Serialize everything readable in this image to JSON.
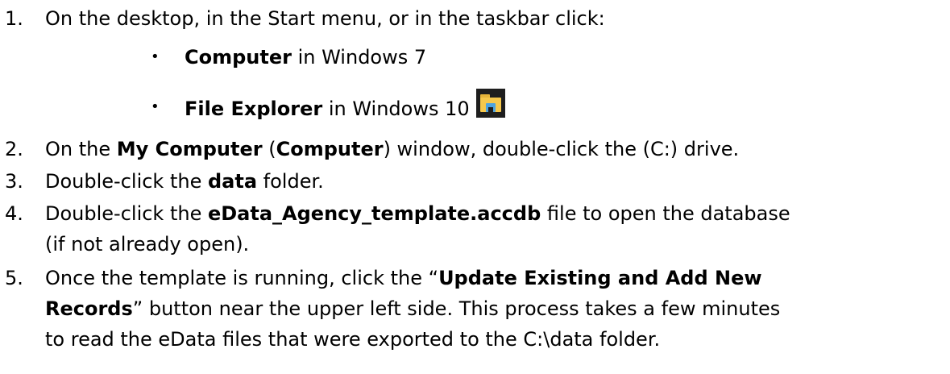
{
  "steps": [
    {
      "num": "1.",
      "parts": [
        "On the desktop, in the Start menu, or in the taskbar click:"
      ]
    },
    {
      "num": "2.",
      "parts": [
        "On the ",
        "My Computer",
        " (",
        "Computer",
        ") window, double-click the (C:) drive."
      ]
    },
    {
      "num": "3.",
      "parts": [
        "Double-click the ",
        "data",
        " folder."
      ]
    },
    {
      "num": "4.",
      "parts": [
        "Double-click the ",
        "eData_Agency_template.accdb",
        " file to open the database"
      ],
      "cont": "(if not already open)."
    },
    {
      "num": "5.",
      "parts": [
        "Once the template is running, click the “",
        "Update Existing and Add New"
      ],
      "cont1_parts": [
        "Records",
        "” button near the upper left side. This process takes a few minutes"
      ],
      "cont2": "to read the eData files that were exported to the C:\\data folder."
    }
  ],
  "bullets": [
    {
      "bullet": "•",
      "bold": "Computer",
      "rest": " in Windows 7"
    },
    {
      "bullet": "•",
      "bold": "File Explorer",
      "rest": " in Windows 10",
      "icon": "file-explorer-icon"
    }
  ]
}
